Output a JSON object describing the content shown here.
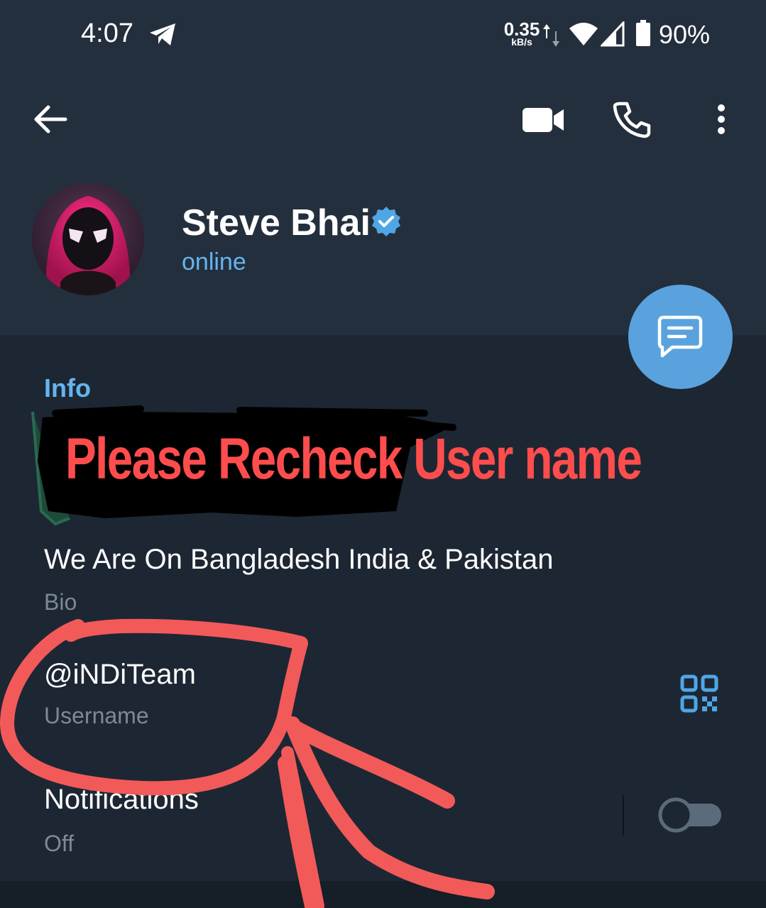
{
  "status_bar": {
    "time": "4:07",
    "net_speed_value": "0.35",
    "net_speed_unit": "kB/s",
    "battery": "90%"
  },
  "profile": {
    "name": "Steve Bhai",
    "status": "online"
  },
  "info": {
    "section_title": "Info",
    "annotation": "Please Recheck User name",
    "bio_value": "We Are On Bangladesh India & Pakistan",
    "bio_label": "Bio",
    "username_value": "@iNDiTeam",
    "username_label": "Username",
    "notifications_label": "Notifications",
    "notifications_value": "Off"
  },
  "colors": {
    "background": "#1d2733",
    "header": "#242f3d",
    "accent": "#64b5ef",
    "fab": "#5aa2de",
    "annotation": "#ff4d4d"
  },
  "icons": [
    "telegram-icon",
    "wifi-icon",
    "cell-signal-icon",
    "battery-icon",
    "back-arrow-icon",
    "video-call-icon",
    "phone-icon",
    "more-vert-icon",
    "verified-badge-icon",
    "message-icon",
    "qr-code-icon"
  ]
}
